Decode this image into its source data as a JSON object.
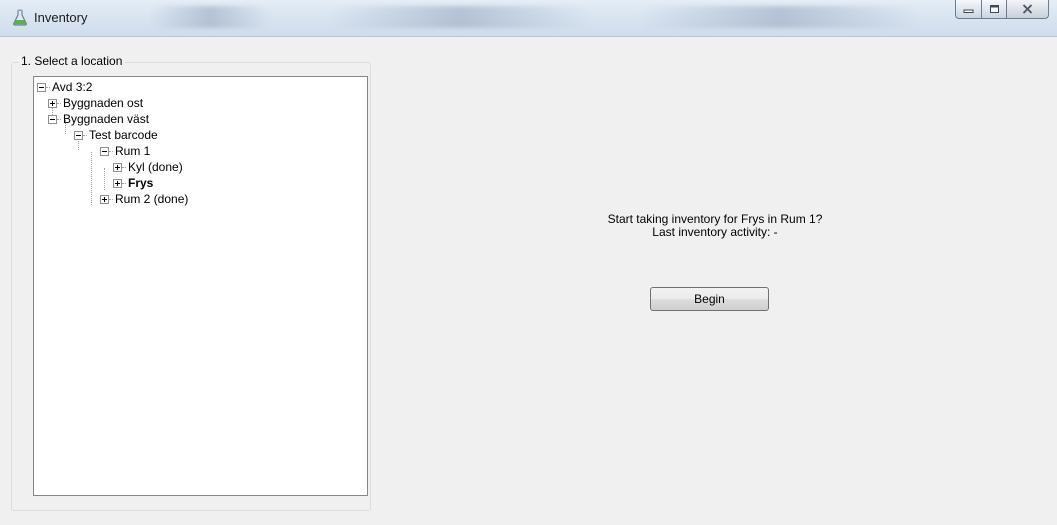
{
  "window": {
    "title": "Inventory",
    "app_icon": "flask-icon",
    "controls": [
      "minimize-icon",
      "maximize-icon",
      "close-icon"
    ]
  },
  "location_group": {
    "label": "1. Select a location"
  },
  "tree": {
    "nodes": [
      {
        "label": "Avd 3:2",
        "level": 0,
        "state": "expanded"
      },
      {
        "label": "Byggnaden ost",
        "level": 1,
        "state": "collapsed"
      },
      {
        "label": "Byggnaden väst",
        "level": 1,
        "state": "expanded"
      },
      {
        "label": "Test barcode",
        "level": 2,
        "state": "expanded"
      },
      {
        "label": "Rum 1",
        "level": 3,
        "state": "expanded"
      },
      {
        "label": "Kyl (done)",
        "level": 4,
        "state": "collapsed"
      },
      {
        "label": "Frys",
        "level": 4,
        "state": "collapsed",
        "selected": true
      },
      {
        "label": "Rum 2 (done)",
        "level": 3,
        "state": "collapsed"
      }
    ]
  },
  "main": {
    "prompt_line1": "Start taking inventory for Frys in Rum 1?",
    "prompt_line2": "Last inventory activity: -",
    "begin_label": "Begin"
  }
}
